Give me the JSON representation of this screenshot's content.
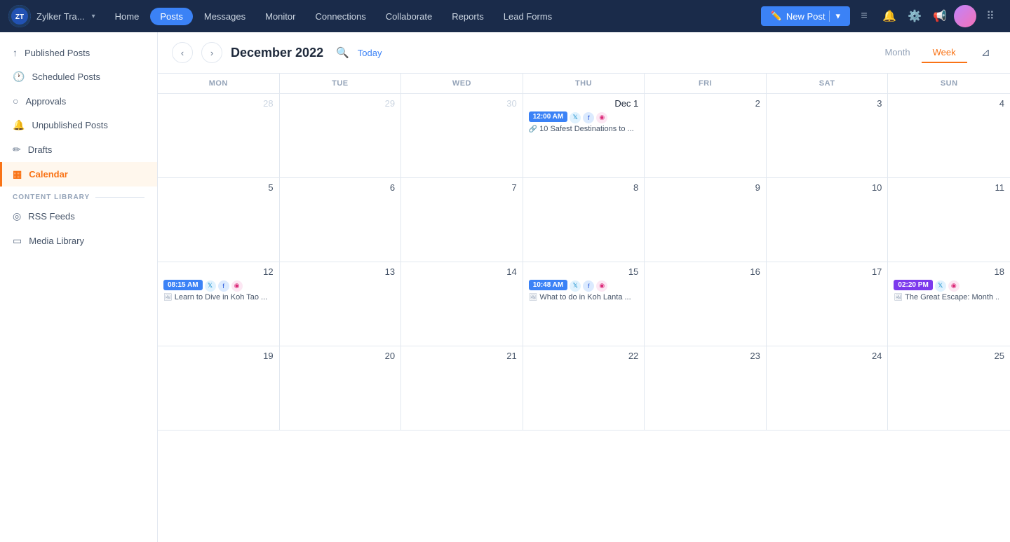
{
  "brand": {
    "name": "Zylker Tra...",
    "chevron": "▾"
  },
  "nav": {
    "items": [
      {
        "label": "Home",
        "active": false
      },
      {
        "label": "Posts",
        "active": true
      },
      {
        "label": "Messages",
        "active": false
      },
      {
        "label": "Monitor",
        "active": false
      },
      {
        "label": "Connections",
        "active": false
      },
      {
        "label": "Collaborate",
        "active": false
      },
      {
        "label": "Reports",
        "active": false
      },
      {
        "label": "Lead Forms",
        "active": false
      }
    ],
    "new_post_label": "New Post"
  },
  "sidebar": {
    "items": [
      {
        "label": "Published Posts",
        "icon": "📤",
        "active": false,
        "id": "published-posts"
      },
      {
        "label": "Scheduled Posts",
        "icon": "🕐",
        "active": false,
        "id": "scheduled-posts"
      },
      {
        "label": "Approvals",
        "icon": "✓",
        "active": false,
        "id": "approvals"
      },
      {
        "label": "Unpublished Posts",
        "icon": "🔔",
        "active": false,
        "id": "unpublished-posts"
      },
      {
        "label": "Drafts",
        "icon": "✏️",
        "active": false,
        "id": "drafts"
      },
      {
        "label": "Calendar",
        "icon": "📅",
        "active": true,
        "id": "calendar"
      }
    ],
    "content_library_label": "CONTENT LIBRARY",
    "content_items": [
      {
        "label": "RSS Feeds",
        "icon": "📡",
        "id": "rss-feeds"
      },
      {
        "label": "Media Library",
        "icon": "🗂️",
        "id": "media-library"
      }
    ]
  },
  "calendar": {
    "title": "December 2022",
    "today_label": "Today",
    "view_month": "Month",
    "view_week": "Week",
    "day_headers": [
      "MON",
      "TUE",
      "WED",
      "THU",
      "FRI",
      "SAT",
      "SUN"
    ],
    "weeks": [
      [
        {
          "num": "28",
          "other": true,
          "events": []
        },
        {
          "num": "29",
          "other": true,
          "events": []
        },
        {
          "num": "30",
          "other": true,
          "events": []
        },
        {
          "num": "Dec 1",
          "other": false,
          "special": true,
          "events": [
            {
              "time": "12:00 AM",
              "color": "blue",
              "socials": [
                "twitter",
                "facebook",
                "instagram"
              ],
              "type": "link",
              "title": "10 Safest Destinations to ..."
            }
          ]
        },
        {
          "num": "2",
          "other": false,
          "events": []
        },
        {
          "num": "3",
          "other": false,
          "events": []
        },
        {
          "num": "4",
          "other": false,
          "events": []
        }
      ],
      [
        {
          "num": "5",
          "other": false,
          "events": []
        },
        {
          "num": "6",
          "other": false,
          "events": []
        },
        {
          "num": "7",
          "other": false,
          "events": []
        },
        {
          "num": "8",
          "other": false,
          "events": []
        },
        {
          "num": "9",
          "other": false,
          "events": []
        },
        {
          "num": "10",
          "other": false,
          "events": []
        },
        {
          "num": "11",
          "other": false,
          "events": []
        }
      ],
      [
        {
          "num": "12",
          "other": false,
          "events": [
            {
              "time": "08:15 AM",
              "color": "blue",
              "socials": [
                "twitter",
                "facebook",
                "instagram"
              ],
              "type": "image",
              "title": "Learn to Dive in Koh Tao ..."
            }
          ]
        },
        {
          "num": "13",
          "other": false,
          "events": []
        },
        {
          "num": "14",
          "other": false,
          "events": []
        },
        {
          "num": "15",
          "other": false,
          "events": [
            {
              "time": "10:48 AM",
              "color": "blue",
              "socials": [
                "twitter",
                "facebook",
                "instagram"
              ],
              "type": "image",
              "title": "What to do in Koh Lanta ..."
            }
          ]
        },
        {
          "num": "16",
          "other": false,
          "events": []
        },
        {
          "num": "17",
          "other": false,
          "events": []
        },
        {
          "num": "18",
          "other": false,
          "events": [
            {
              "time": "02:20 PM",
              "color": "purple",
              "socials": [
                "twitter",
                "instagram"
              ],
              "type": "image",
              "title": "The Great Escape: Month ..."
            }
          ]
        }
      ],
      [
        {
          "num": "19",
          "other": false,
          "events": []
        },
        {
          "num": "20",
          "other": false,
          "events": []
        },
        {
          "num": "21",
          "other": false,
          "events": []
        },
        {
          "num": "22",
          "other": false,
          "events": []
        },
        {
          "num": "23",
          "other": false,
          "events": []
        },
        {
          "num": "24",
          "other": false,
          "events": []
        },
        {
          "num": "25",
          "other": false,
          "events": []
        }
      ]
    ]
  }
}
